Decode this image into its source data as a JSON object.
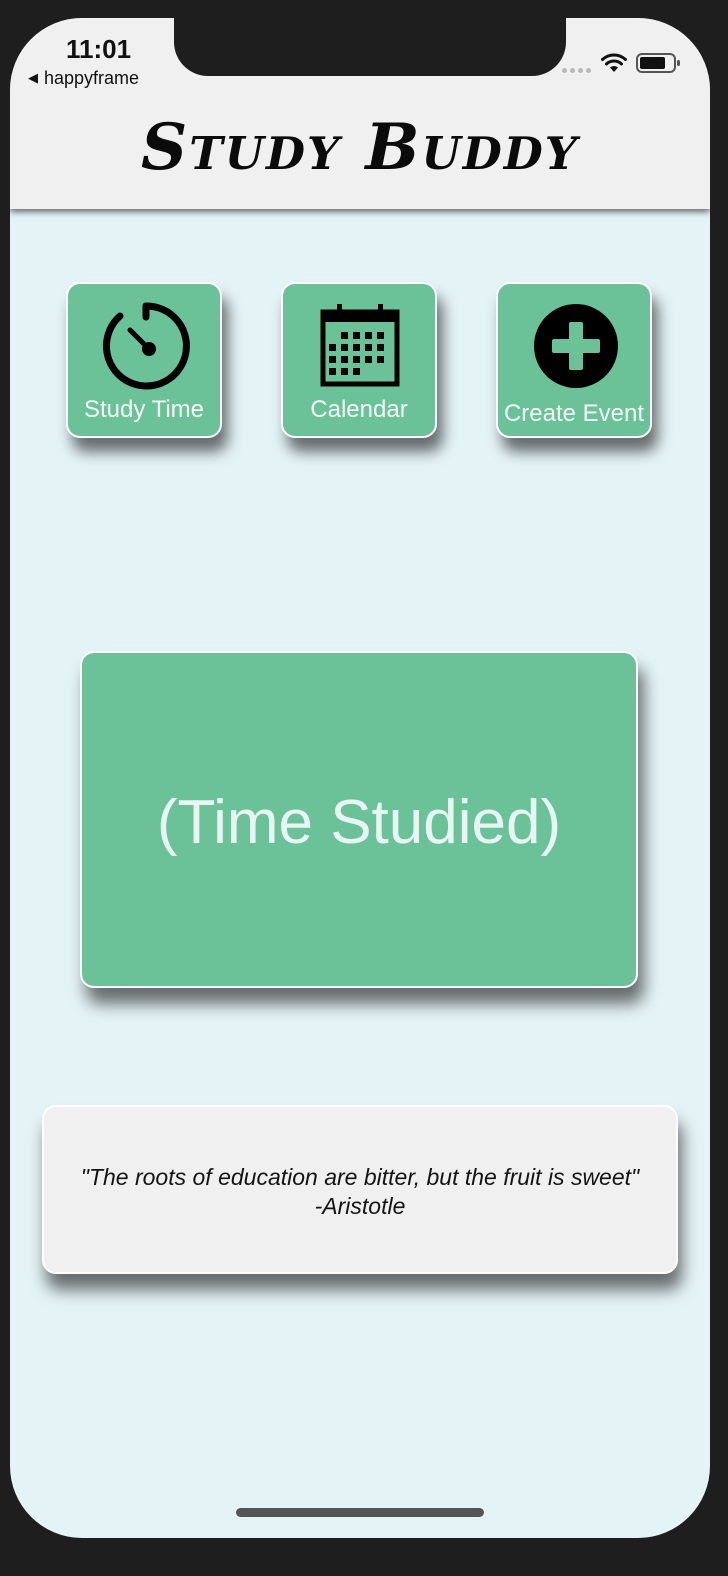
{
  "status_bar": {
    "time": "11:01",
    "back_app": "happyframe",
    "back_icon": "back-triangle-icon",
    "icons": [
      "cellular-signal-icon",
      "wifi-icon",
      "battery-icon"
    ]
  },
  "header": {
    "title": "Study Buddy"
  },
  "tiles": [
    {
      "label": "Study Time",
      "icon": "stopwatch-icon"
    },
    {
      "label": "Calendar",
      "icon": "calendar-icon"
    },
    {
      "label": "Create Event",
      "icon": "plus-circle-icon"
    }
  ],
  "study_card": {
    "value": "(Time Studied)"
  },
  "quote": {
    "text": "\"The roots of education are bitter, but the fruit is sweet\"",
    "author": "-Aristotle"
  },
  "colors": {
    "tile_green": "#6cc298",
    "screen_background": "#e4f3f6",
    "header_background": "#f0f0f0",
    "quote_background": "#f0f0f0"
  }
}
